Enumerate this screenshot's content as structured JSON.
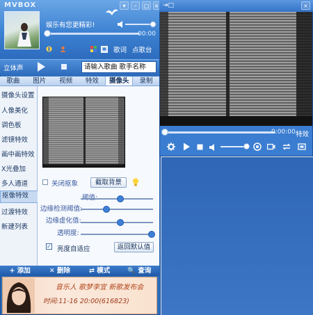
{
  "app": {
    "name": "MVBOX"
  },
  "player": {
    "slogan": "娱乐有您更精彩!",
    "time": "00:00",
    "link_song": "歌词",
    "link_stage": "点歌台",
    "stereo": "立体声",
    "search_placeholder": "请输入歌曲 歌手名称"
  },
  "tabs": [
    "歌曲",
    "图片",
    "视频",
    "特效",
    "摄像头",
    "录制"
  ],
  "active_tab": 4,
  "side_menu": [
    "摄像头设置",
    "人像美化",
    "调色板",
    "滤镜特效",
    "画中画特效",
    "X光叠加",
    "多人通道",
    "抠像特效",
    "过渡特效",
    "新建列表"
  ],
  "selected_menu": 7,
  "camera_panel": {
    "close_camera": "关闭抠象",
    "capture_bg": "截取背景",
    "sliders": [
      {
        "label": "阈值:",
        "value": 0.55
      },
      {
        "label": "边缘检测阈值:",
        "value": 0.36
      },
      {
        "label": "边缘虚化值:",
        "value": 0.55
      },
      {
        "label": "透明度:",
        "value": 0.98
      }
    ],
    "auto_brightness": "亮度自适应",
    "auto_brightness_checked": true,
    "restore_default": "返回默认值"
  },
  "bottom_bar": {
    "add": "+ 添加",
    "delete": "✕ 删除",
    "mode": "⇄ 模式",
    "find": "🔍 查询"
  },
  "banner": {
    "line1": "音乐人  歌梦李宜  新歌发布会",
    "line2": "时间:11-16  20:00(616823)"
  },
  "video_window": {
    "time": "0:00:00",
    "fx": "特效"
  }
}
